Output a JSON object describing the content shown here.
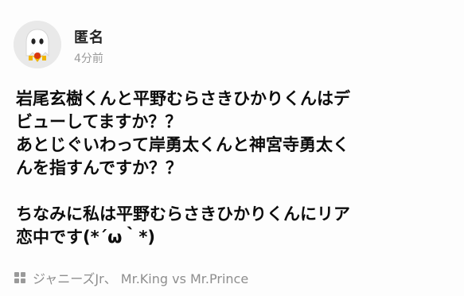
{
  "post": {
    "author": "匿名",
    "time": "4分前",
    "body_lines": [
      "岩尾玄樹くんと平野むらさきひかりくんはデ",
      "ビューしてますか？？",
      "あとじぐいわって岸勇太くんと神宮寺勇太く",
      "んを指すんですか？？",
      "",
      "ちなみに私は平野むらさきひかりくんにリア",
      "恋中です(*´ω｀*)"
    ],
    "tags": "ジャニーズJr、 Mr.King vs Mr.Prince"
  },
  "icons": {
    "avatar": "ghost-avatar-icon",
    "tag": "category-grid-icon"
  },
  "colors": {
    "avatar_bg": "#e9e9e9",
    "text": "#0d0d0d",
    "meta": "#9a9a9a"
  }
}
